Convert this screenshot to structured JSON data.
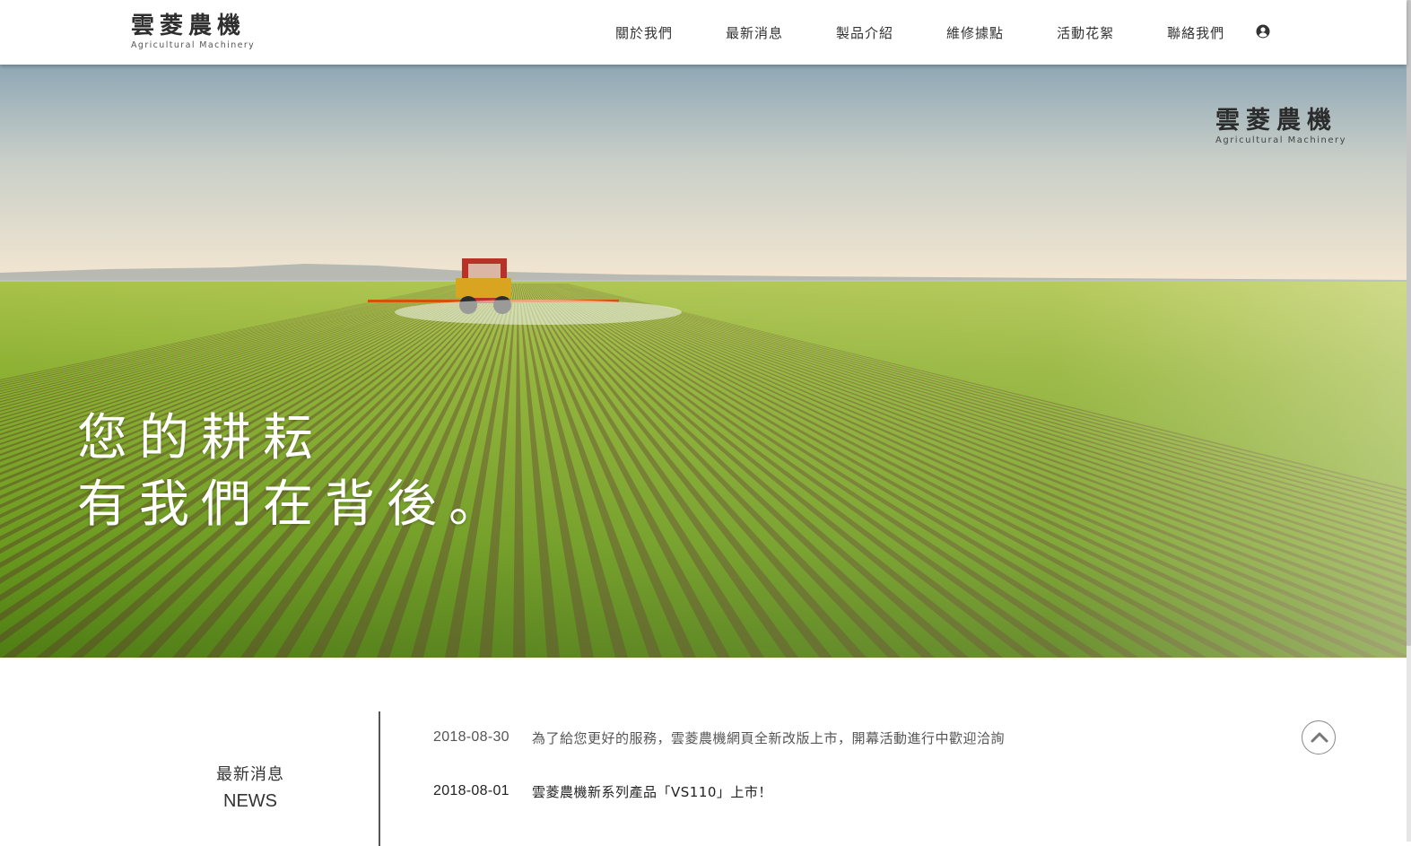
{
  "header": {
    "logo_cn": "雲菱農機",
    "logo_en": "Agricultural Machinery",
    "nav": [
      {
        "label": "關於我們"
      },
      {
        "label": "最新消息"
      },
      {
        "label": "製品介紹"
      },
      {
        "label": "維修據點"
      },
      {
        "label": "活動花絮"
      },
      {
        "label": "聯絡我們"
      }
    ],
    "user_icon": "user-circle-icon"
  },
  "hero": {
    "logo_cn": "雲菱農機",
    "logo_en": "Agricultural Machinery",
    "tagline_line1": "您的耕耘",
    "tagline_line2": "有我們在背後。"
  },
  "news": {
    "title_cn": "最新消息",
    "title_en": "NEWS",
    "items": [
      {
        "date": "2018-08-30",
        "text": "為了給您更好的服務，雲菱農機網頁全新改版上市，開幕活動進行中歡迎洽詢"
      },
      {
        "date": "2018-08-01",
        "text": "雲菱農機新系列產品「VS110」上市！"
      }
    ],
    "back_to_top_icon": "chevron-up-icon"
  },
  "colors": {
    "sky_top": "#8fa8b6",
    "sky_horizon": "#efe3cf",
    "field_green": "#6f9a1f",
    "tractor_red": "#c0392b"
  }
}
